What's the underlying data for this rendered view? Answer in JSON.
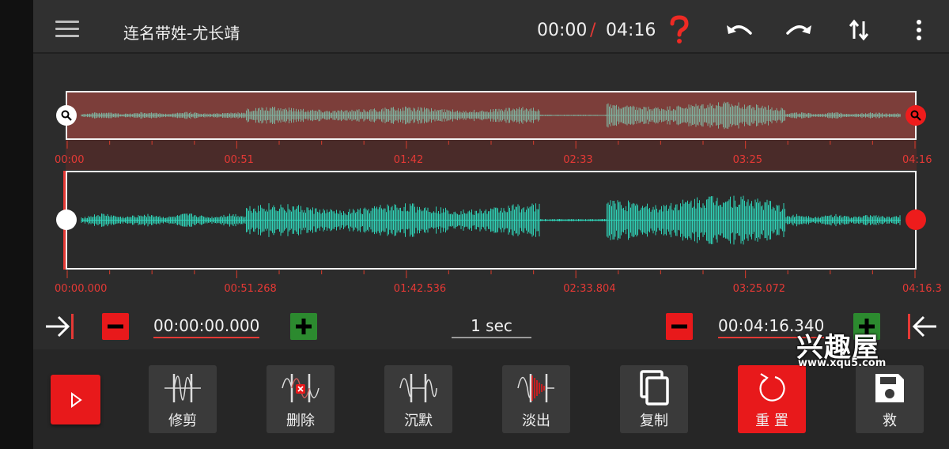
{
  "header": {
    "title": "连名带姓-尤长靖",
    "current_time": "00:00",
    "separator": "/",
    "total_time": "04:16",
    "icons": [
      "menu-icon",
      "help-icon",
      "undo-icon",
      "redo-icon",
      "swap-vertical-icon",
      "more-vertical-icon"
    ]
  },
  "overview": {
    "tick_labels": [
      "00:00",
      "00:51",
      "01:42",
      "02:33",
      "03:25",
      "04:16"
    ]
  },
  "waveform": {
    "tick_labels": [
      "00:00.000",
      "00:51.268",
      "01:42.536",
      "02:33.804",
      "03:25.072",
      "04:16.3"
    ]
  },
  "controls": {
    "start_time": "00:00:00.000",
    "step": "1 sec",
    "end_time": "00:04:16.340"
  },
  "tools": [
    {
      "label": "修剪",
      "icon": "trim-icon"
    },
    {
      "label": "删除",
      "icon": "delete-segment-icon"
    },
    {
      "label": "沉默",
      "icon": "silence-icon"
    },
    {
      "label": "淡出",
      "icon": "fade-out-icon"
    },
    {
      "label": "复制",
      "icon": "copy-icon"
    },
    {
      "label": "重 置",
      "icon": "reset-icon"
    },
    {
      "label": "救",
      "icon": "save-icon"
    }
  ],
  "watermark": {
    "text": "兴趣屋",
    "url": "www.xqu5.com"
  },
  "colors": {
    "accent": "#e8191b",
    "wave": "#2fd1b6",
    "wave_overview": "#7fae9b",
    "positive": "#2c8a2f",
    "background": "#2c2c2c"
  }
}
